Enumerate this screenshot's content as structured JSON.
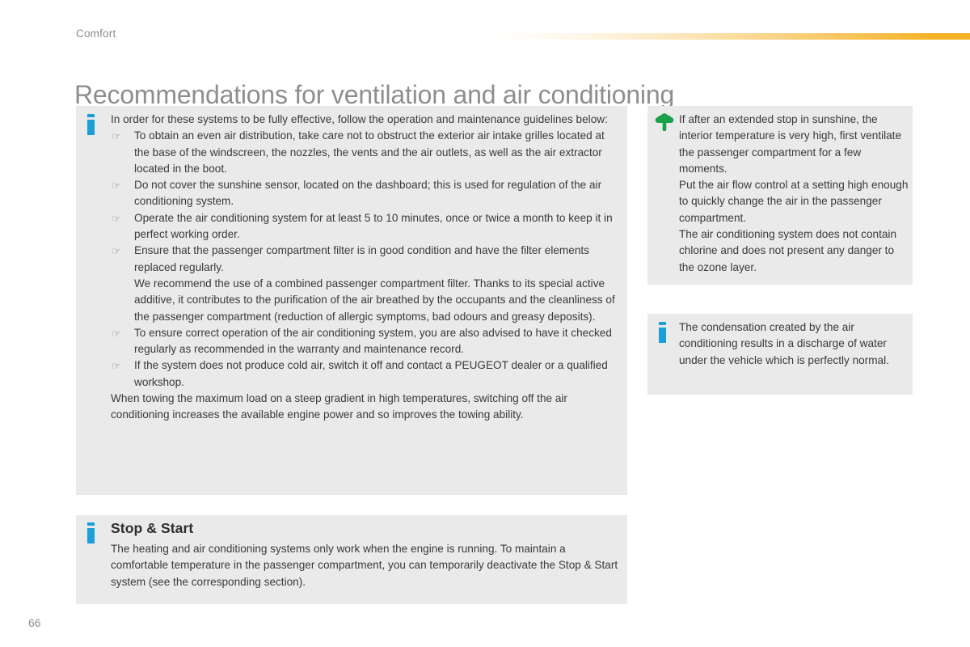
{
  "header": {
    "section_label": "Comfort",
    "title": "Recommendations for ventilation and air conditioning",
    "accent_color": "#f5b227"
  },
  "footer": {
    "page_number": "66"
  },
  "icons": {
    "info": "info-icon",
    "tree": "eco-tree-icon",
    "bullet": "☞"
  },
  "main_panel": {
    "icon": "info-icon",
    "intro": "In order for these systems to be fully effective, follow the operation and maintenance guidelines below:",
    "bullets": [
      {
        "text": "To obtain an even air distribution, take care not to obstruct the exterior air intake grilles located at the base of the windscreen, the nozzles, the vents and the air outlets, as well as the air extractor located in the boot."
      },
      {
        "text": "Do not cover the sunshine sensor, located on the dashboard; this is used for regulation of the air conditioning system."
      },
      {
        "text": "Operate the air conditioning system for at least 5 to 10 minutes, once or twice a month to keep it in perfect working order."
      },
      {
        "text": "Ensure that the passenger compartment filter is in good condition and have the filter elements replaced regularly.",
        "sub": "We recommend the use of a combined passenger compartment filter. Thanks to its special active additive, it contributes to the purification of the air breathed by the occupants and the cleanliness of the passenger compartment (reduction of allergic symptoms, bad odours and greasy deposits)."
      },
      {
        "text": "To ensure correct operation of the air conditioning system, you are also advised to have it checked regularly as recommended in the warranty and maintenance record."
      },
      {
        "text": "If the system does not produce cold air, switch it off and contact a PEUGEOT dealer or a qualified workshop."
      }
    ],
    "closing": "When towing the maximum load on a steep gradient in high temperatures, switching off the air conditioning increases the available engine power and so improves the towing ability."
  },
  "eco_panel": {
    "icon": "eco-tree-icon",
    "icon_color": "#1ba14c",
    "paragraphs": [
      "If after an extended stop in sunshine, the interior temperature is very high, first ventilate the passenger compartment for a few moments.",
      "Put the air flow control at a setting high enough to quickly change the air in the passenger compartment.",
      "The air conditioning system does not contain chlorine and does not present any danger to the ozone layer."
    ]
  },
  "condensation_panel": {
    "icon": "info-icon",
    "icon_color": "#1a9fd9",
    "paragraphs": [
      "The condensation created by the air conditioning results in a discharge of water under the vehicle which is perfectly normal."
    ]
  },
  "stop_start_panel": {
    "icon": "info-icon",
    "heading": "Stop & Start",
    "paragraphs": [
      "The heating and air conditioning systems only work when the engine is running. To maintain a comfortable temperature in the passenger compartment, you can temporarily deactivate the Stop & Start system (see the corresponding section)."
    ]
  }
}
